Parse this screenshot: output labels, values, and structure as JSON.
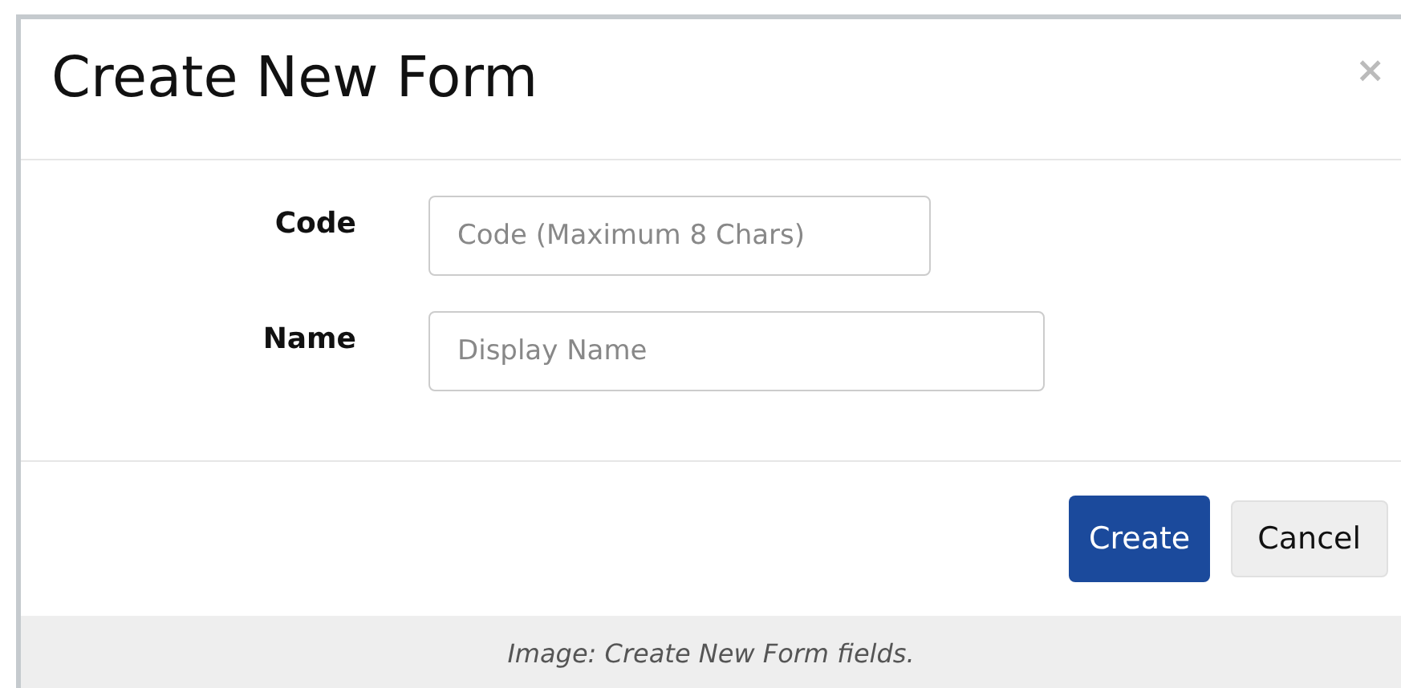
{
  "dialog": {
    "title": "Create New Form",
    "close": "×"
  },
  "fields": [
    {
      "label": "Code",
      "placeholder": "Code (Maximum 8 Chars)"
    },
    {
      "label": "Name",
      "placeholder": "Display Name"
    }
  ],
  "buttons": [
    {
      "label": "Create",
      "kind": "primary"
    },
    {
      "label": "Cancel",
      "kind": "secondary"
    }
  ],
  "caption": "Image: Create New Form fields."
}
